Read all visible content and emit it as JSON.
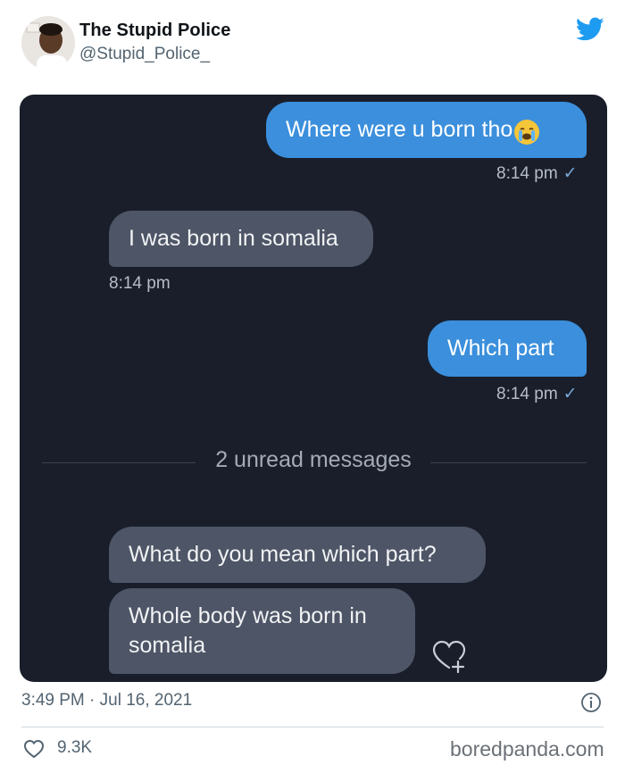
{
  "tweet": {
    "author_name": "The Stupid Police",
    "handle": "@Stupid_Police_",
    "timestamp": "3:49 PM · Jul 16, 2021",
    "likes": "9.3K",
    "platform_icon": "twitter-bird-icon"
  },
  "chat": {
    "messages": [
      {
        "direction": "outgoing",
        "text": "Where were u born tho",
        "emoji": "crying-face-emoji",
        "time": "8:14 pm",
        "status": "✓"
      },
      {
        "direction": "incoming",
        "text": "I was born in somalia",
        "time": "8:14 pm"
      },
      {
        "direction": "outgoing",
        "text": "Which part",
        "time": "8:14 pm",
        "status": "✓"
      },
      {
        "direction": "incoming",
        "text": "What do you mean which part?"
      },
      {
        "direction": "incoming",
        "text": "Whole body was born in somalia"
      }
    ],
    "unread_divider": "2 unread messages",
    "colors": {
      "background": "#191e2a",
      "outgoing_bubble": "#3b8fdc",
      "incoming_bubble": "#4d5566"
    }
  },
  "watermark": "boredpanda.com",
  "colors": {
    "twitter_blue": "#1d9bf0",
    "secondary_text": "#536471"
  }
}
